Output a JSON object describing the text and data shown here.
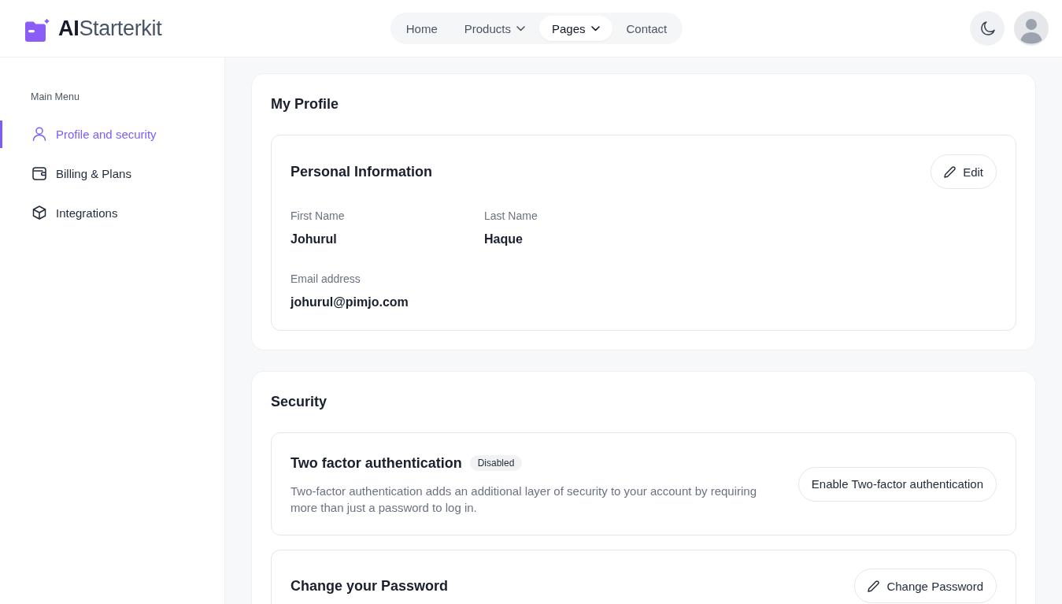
{
  "header": {
    "logo": "**AI**Starterkit",
    "nav": [
      {
        "label": "Home",
        "dropdown": false,
        "selected": false
      },
      {
        "label": "Products",
        "dropdown": true,
        "selected": false
      },
      {
        "label": "Pages",
        "dropdown": true,
        "selected": true
      },
      {
        "label": "Contact",
        "dropdown": false,
        "selected": false
      }
    ]
  },
  "sidebar": {
    "heading": "Main Menu",
    "items": [
      {
        "label": "Profile and security",
        "selected": true
      },
      {
        "label": "Billing & Plans",
        "selected": false
      },
      {
        "label": "Integrations",
        "selected": false
      }
    ]
  },
  "profile": {
    "title": "My Profile",
    "section": {
      "title": "Personal Information",
      "edit_button": "Edit",
      "fields": [
        {
          "label": "First Name",
          "value": "Johurul"
        },
        {
          "label": "Last Name",
          "value": "Haque"
        },
        {
          "label": "Email address",
          "value": "johurul@pimjo.com"
        }
      ]
    }
  },
  "security": {
    "title": "Security",
    "items": [
      {
        "kind": "setting",
        "title": "Two factor authentication",
        "badge": "Disabled",
        "description": "Two-factor authentication adds an additional layer of security to your account by requiring more than just a password to log in.",
        "button": "Enable Two-factor authentication"
      },
      {
        "kind": "edit",
        "title": "Change your Password",
        "button": "Change Password"
      }
    ]
  }
}
